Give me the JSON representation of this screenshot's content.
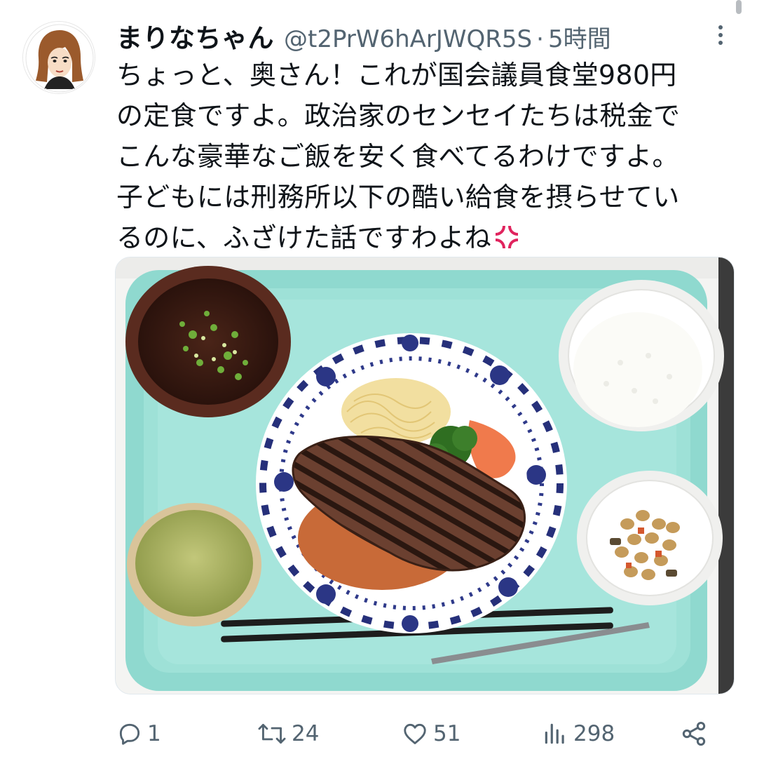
{
  "tweet": {
    "display_name": "まりなちゃん",
    "handle": "@t2PrW6hArJWQR5S",
    "separator": "·",
    "time": "5時間",
    "text_lines": [
      "ちょっと、奥さん！これが国会議員食堂980円",
      "の定食ですよ。政治家のセンセイたちは税金で",
      "こんな豪華なご飯を安く食べてるわけですよ。",
      "子どもには刑務所以下の酷い給食を摂らせてい",
      "るのに、ふざけた話ですわよね"
    ],
    "emoji": "anger-symbol"
  },
  "actions": {
    "reply_count": "1",
    "retweet_count": "24",
    "like_count": "51",
    "views_count": "298"
  },
  "colors": {
    "text": "#0f1419",
    "secondary": "#536471",
    "tray": "#8fd9cf",
    "anger": "#e0245e"
  }
}
